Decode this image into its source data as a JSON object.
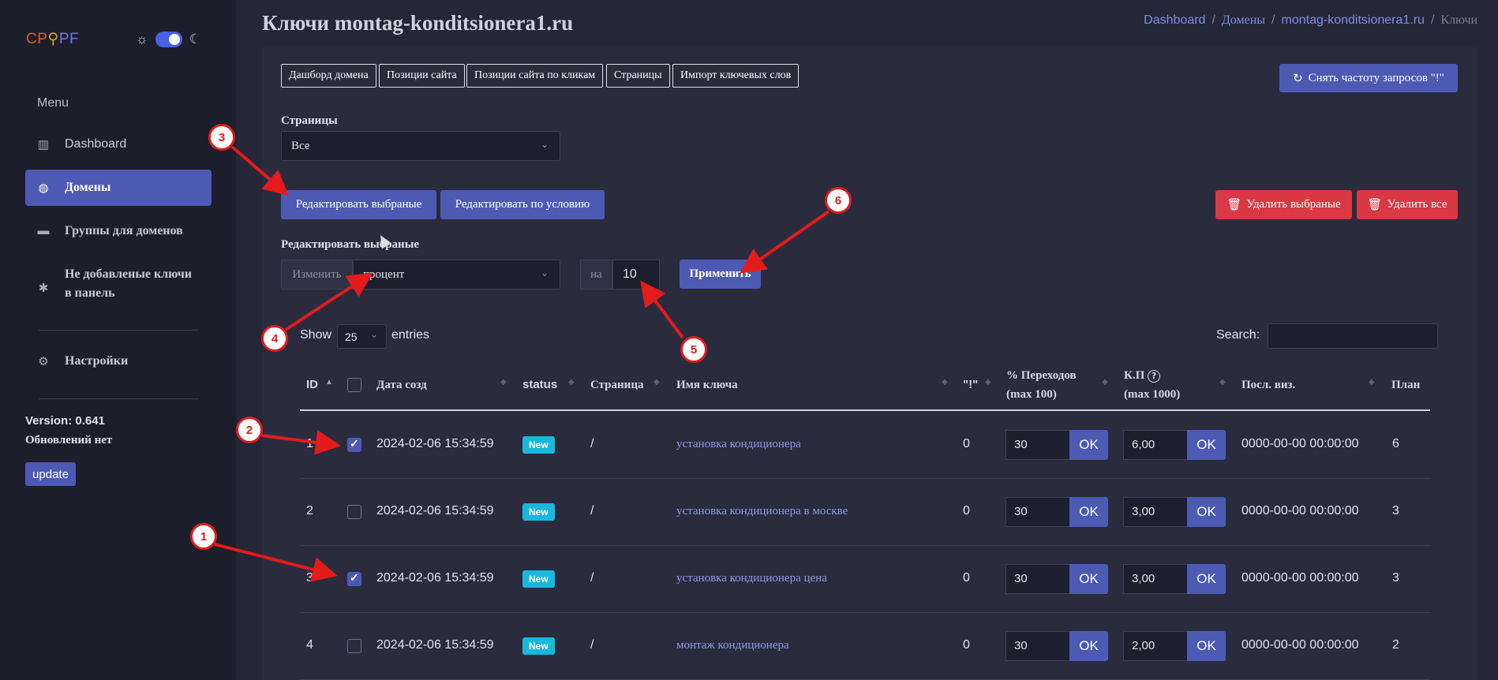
{
  "sidebar": {
    "logo_cp": "CP",
    "logo_pf": "PF",
    "menu_title": "Menu",
    "items": [
      {
        "label": "Dashboard",
        "icon": "chart-bar-icon"
      },
      {
        "label": "Домены",
        "icon": "globe-icon"
      },
      {
        "label": "Группы для доменов",
        "icon": "briefcase-icon"
      },
      {
        "label": "Не добавленые ключи в панель",
        "icon": "bug-icon"
      },
      {
        "label": "Настройки",
        "icon": "gear-icon"
      }
    ],
    "version": "Version: 0.641",
    "updates": "Обновлений нет",
    "update_button": "update"
  },
  "header": {
    "title": "Ключи montag-konditsionera1.ru",
    "breadcrumb": [
      "Dashboard",
      "Домены",
      "montag-konditsionera1.ru",
      "Ключи"
    ]
  },
  "tabs": [
    "Дашборд домена",
    "Позиции сайта",
    "Позиции сайта по кликам",
    "Страницы",
    "Импорт ключевых слов"
  ],
  "reset_button": "Снять частоту запросов \"!\"",
  "pages_filter": {
    "label": "Страницы",
    "value": "Все"
  },
  "actions": {
    "edit_selected": "Редактировать выбраные",
    "edit_by_condition": "Редактировать по условию",
    "delete_selected": "Удалить выбраные",
    "delete_all": "Удалить все"
  },
  "edit_form": {
    "title": "Редактировать выбраные",
    "change_label": "Изменить",
    "mode_value": "процент",
    "on_label": "на",
    "amount_value": "10",
    "apply_button": "Применить"
  },
  "table_controls": {
    "show_label": "Show",
    "page_size": "25",
    "entries_label": "entries",
    "search_label": "Search:"
  },
  "columns": {
    "id": "ID",
    "date": "Дата созд",
    "status": "status",
    "page": "Страница",
    "key_name": "Имя ключа",
    "exclaim": "\"!\"",
    "transitions_1": "% Переходов",
    "transitions_2": "(max 100)",
    "kp_1": "К.П",
    "kp_2": "(max 1000)",
    "last_visit": "Посл. виз.",
    "plan": "План"
  },
  "ok_label": "OK",
  "rows": [
    {
      "id": "1",
      "checked": true,
      "date": "2024-02-06 15:34:59",
      "status": "New",
      "page": "/",
      "key": "установка кондиционера",
      "exclaim": "0",
      "transitions": "30",
      "kp": "6,00",
      "last_visit": "0000-00-00 00:00:00",
      "plan": "6"
    },
    {
      "id": "2",
      "checked": false,
      "date": "2024-02-06 15:34:59",
      "status": "New",
      "page": "/",
      "key": "установка кондиционера в москве",
      "exclaim": "0",
      "transitions": "30",
      "kp": "3,00",
      "last_visit": "0000-00-00 00:00:00",
      "plan": "3"
    },
    {
      "id": "3",
      "checked": true,
      "date": "2024-02-06 15:34:59",
      "status": "New",
      "page": "/",
      "key": "установка кондиционера цена",
      "exclaim": "0",
      "transitions": "30",
      "kp": "3,00",
      "last_visit": "0000-00-00 00:00:00",
      "plan": "3"
    },
    {
      "id": "4",
      "checked": false,
      "date": "2024-02-06 15:34:59",
      "status": "New",
      "page": "/",
      "key": "монтаж кондиционера",
      "exclaim": "0",
      "transitions": "30",
      "kp": "2,00",
      "last_visit": "0000-00-00 00:00:00",
      "plan": "2"
    }
  ],
  "annotations": [
    "1",
    "2",
    "3",
    "4",
    "5",
    "6"
  ],
  "colors": {
    "accent": "#4c5ab4",
    "danger": "#d93844",
    "badge": "#19b8dd",
    "annotation": "#e31b1b"
  }
}
